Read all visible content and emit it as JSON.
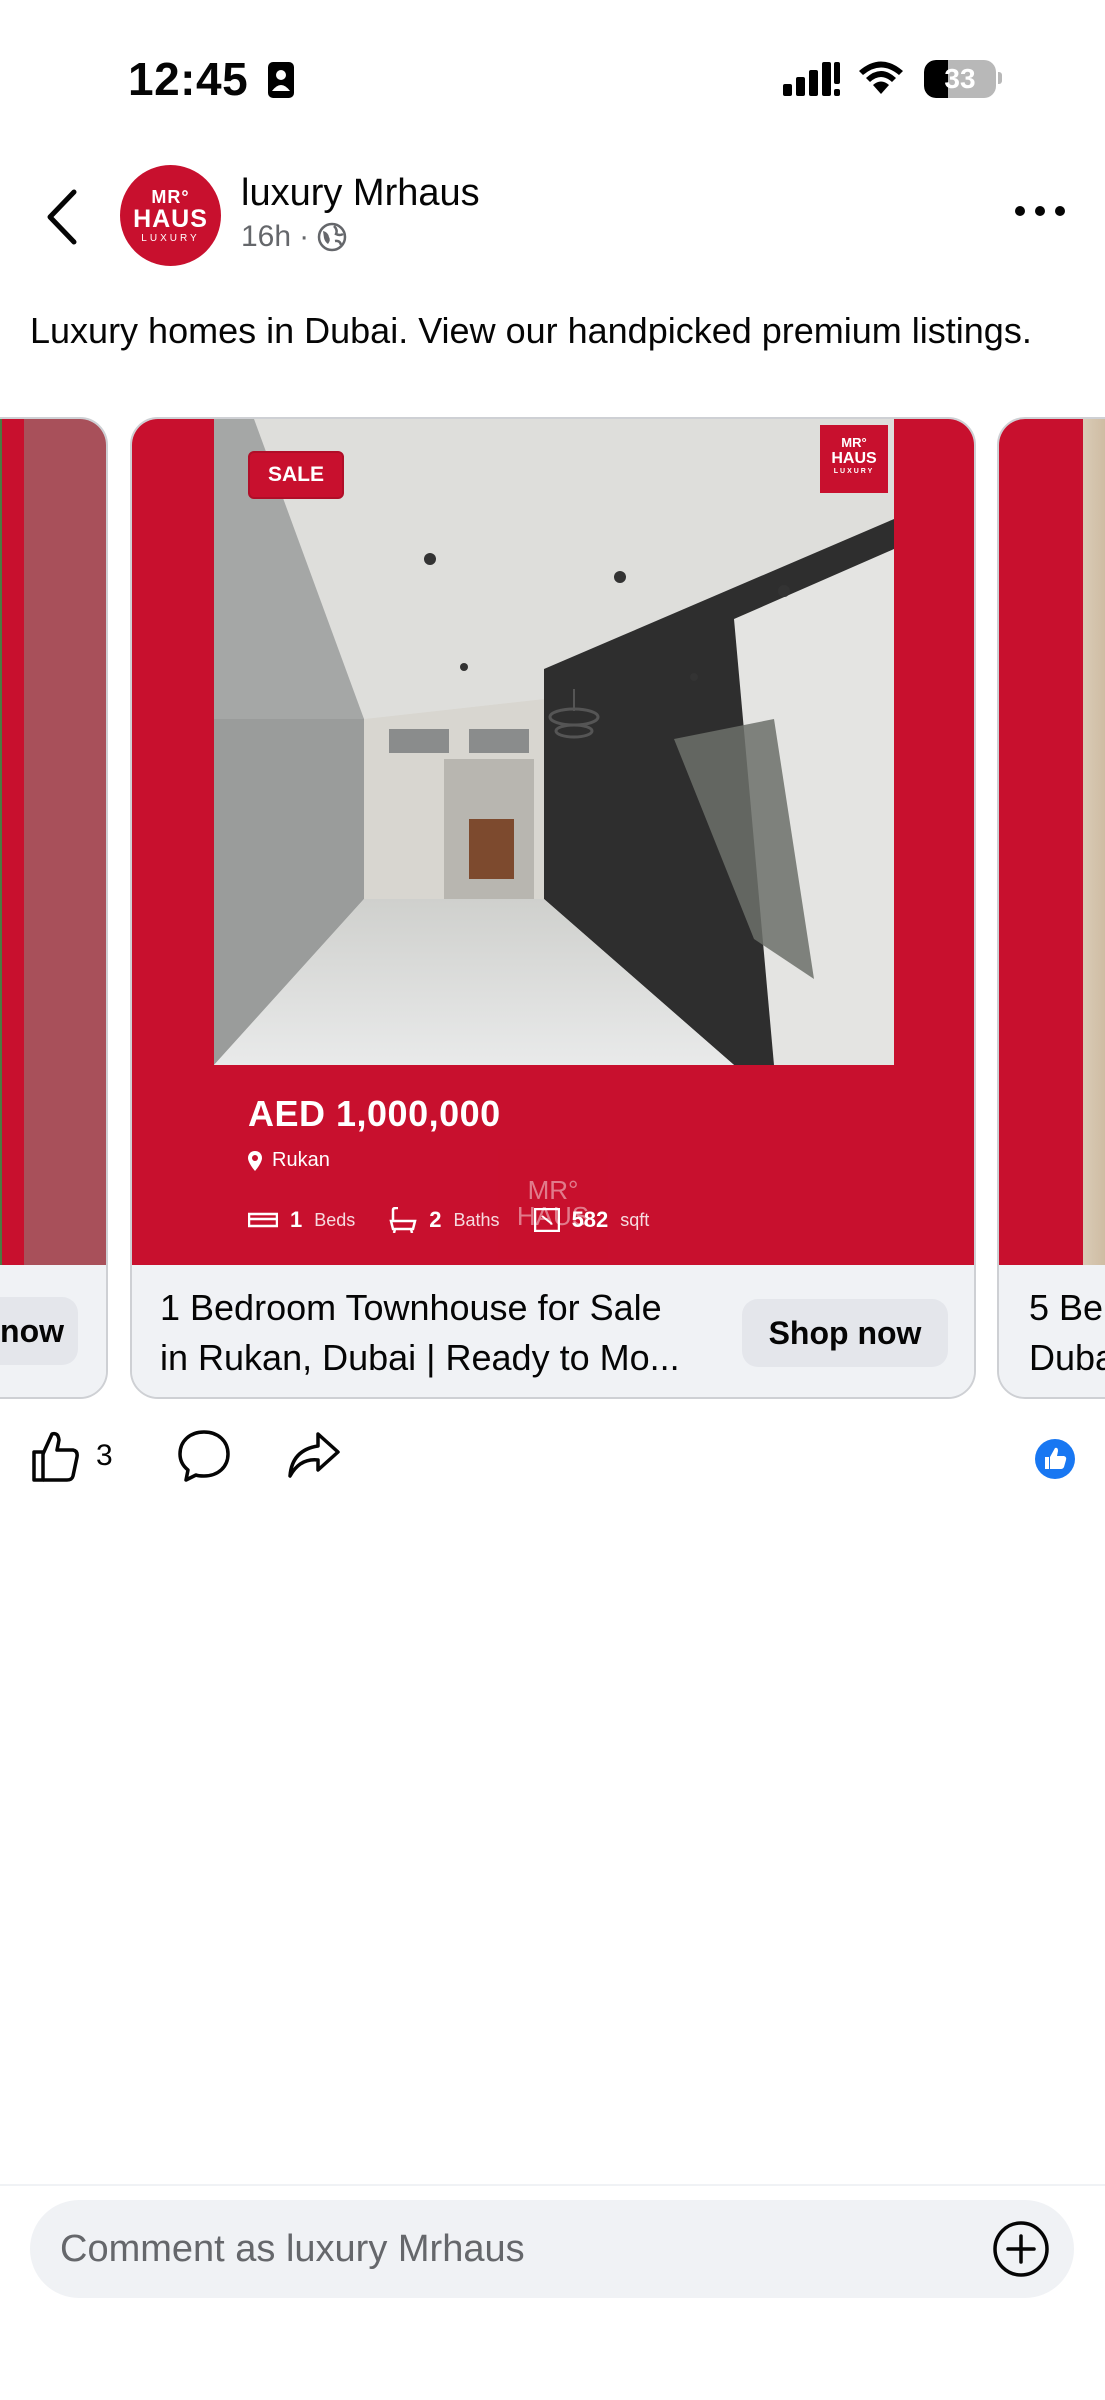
{
  "status_bar": {
    "time": "12:45",
    "battery": "33"
  },
  "header": {
    "page_name": "luxury Mrhaus",
    "time_ago": "16h",
    "separator": "·",
    "avatar": {
      "mr": "MR°",
      "haus": "HAUS",
      "lux": "LUXURY"
    }
  },
  "caption": "Luxury homes in Dubai. View our handpicked premium listings.",
  "carousel": {
    "main": {
      "badge": "SALE",
      "logo": {
        "mr": "MR°",
        "haus": "HAUS",
        "lux": "LUXURY"
      },
      "price": "AED 1,000,000",
      "location": "Rukan",
      "beds_value": "1",
      "beds_label": "Beds",
      "baths_value": "2",
      "baths_label": "Baths",
      "area_value": "582",
      "area_label": "sqft",
      "watermark": "MR° HAUS",
      "title_line1": "1 Bedroom Townhouse for Sale",
      "title_line2": "in Rukan, Dubai | Ready to Mo...",
      "cta": "Shop now"
    },
    "prev": {
      "cta": "now"
    },
    "next": {
      "title_line1": "5 Be",
      "title_line2": "Duba"
    }
  },
  "actions": {
    "like_count": "3"
  },
  "comment_input": {
    "placeholder": "Comment as luxury Mrhaus"
  },
  "colors": {
    "brand_red": "#c8102e",
    "facebook_blue": "#1877f2",
    "muted": "#65676b"
  }
}
